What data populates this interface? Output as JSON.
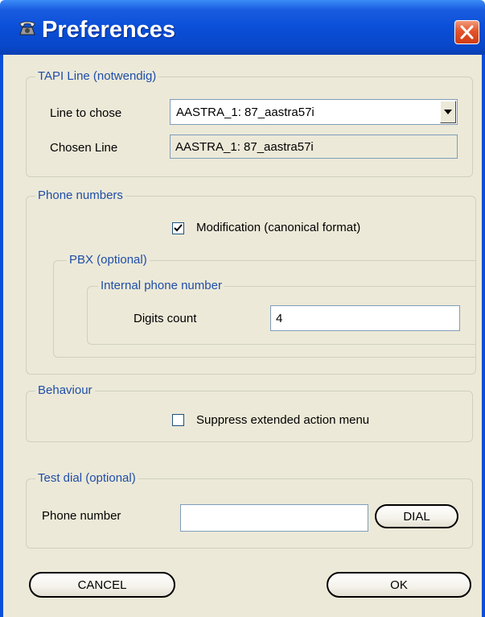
{
  "window": {
    "title": "Preferences",
    "app_icon": "telephone-icon",
    "close_icon": "close-icon"
  },
  "tapi": {
    "legend": "TAPI Line (notwendig)",
    "line_label": "Line to chose",
    "line_value": "AASTRA_1: 87_aastra57i",
    "chosen_label": "Chosen Line",
    "chosen_value": "AASTRA_1: 87_aastra57i"
  },
  "phone_numbers": {
    "legend": "Phone numbers",
    "modification_label": "Modification (canonical format)",
    "modification_checked": true,
    "pbx": {
      "legend": "PBX (optional)",
      "internal": {
        "legend": "Internal phone number",
        "digits_label": "Digits count",
        "digits_value": "4"
      }
    }
  },
  "behaviour": {
    "legend": "Behaviour",
    "suppress_label": "Suppress extended action menu",
    "suppress_checked": false
  },
  "test_dial": {
    "legend": "Test dial (optional)",
    "phone_label": "Phone number",
    "phone_value": "",
    "dial_label": "DIAL"
  },
  "footer": {
    "cancel_label": "CANCEL",
    "ok_label": "OK"
  },
  "colors": {
    "titlebar": "#0a4fd8",
    "window_bg": "#ece9d8",
    "legend_text": "#1f4ea8",
    "close_button": "#d03c14"
  }
}
